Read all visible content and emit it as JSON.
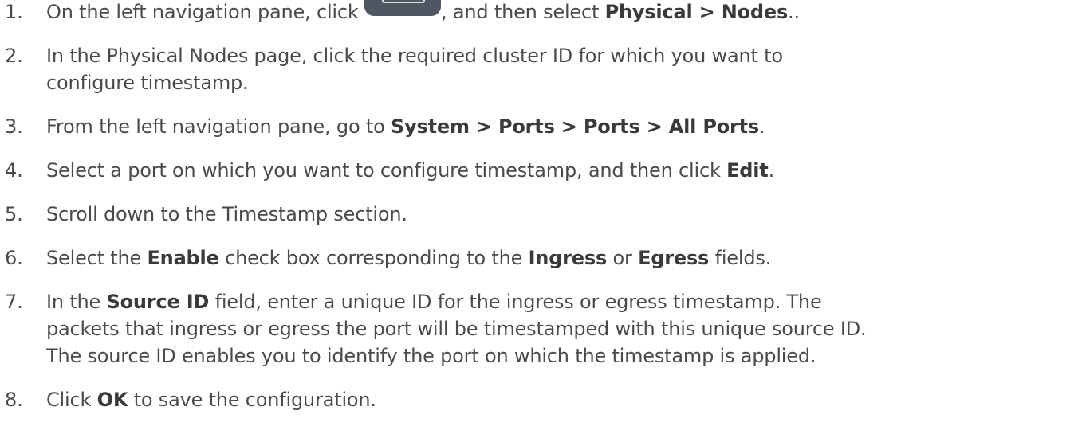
{
  "steps": [
    {
      "num": "1.",
      "t1": "On the left navigation pane, click ",
      "icon": "navigation-menu-icon",
      "t2": ", and then select ",
      "b1": "Physical > Nodes",
      "t3": ".."
    },
    {
      "num": "2.",
      "line1": "In the Physical Nodes page, click the required cluster ID for which you want to",
      "line2": "configure timestamp."
    },
    {
      "num": "3.",
      "t1": "From the left navigation pane, go to ",
      "b1": "System > Ports > Ports > All Ports",
      "t2": "."
    },
    {
      "num": "4.",
      "t1": "Select a port on which you want to configure timestamp, and then click ",
      "b1": "Edit",
      "t2": "."
    },
    {
      "num": "5.",
      "t1": "Scroll down to the Timestamp section."
    },
    {
      "num": "6.",
      "t1": "Select the ",
      "b1": "Enable",
      "t2": " check box corresponding to the ",
      "b2": "Ingress",
      "t3": " or ",
      "b3": "Egress",
      "t4": " fields."
    },
    {
      "num": "7.",
      "t1": "In the ",
      "b1": "Source ID",
      "t2": " field, enter a unique ID for the ingress or egress timestamp. The",
      "line2": "packets that ingress or egress the port will be timestamped with this unique source ID.",
      "line3": "The source ID enables you to identify the port on which the timestamp is applied."
    },
    {
      "num": "8.",
      "t1": "Click ",
      "b1": "OK",
      "t2": " to save the configuration."
    }
  ]
}
